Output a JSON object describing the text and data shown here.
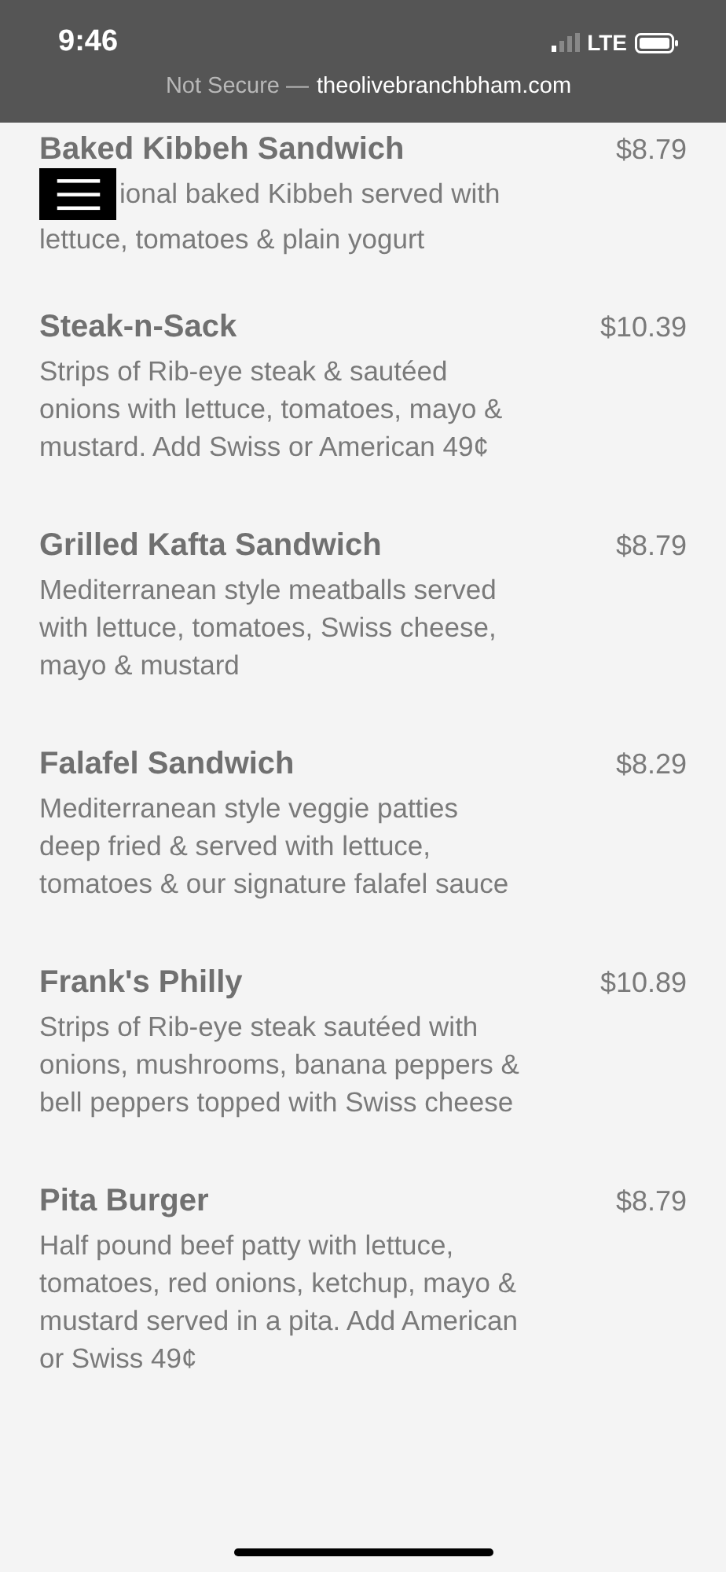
{
  "status_bar": {
    "time": "9:46",
    "network": "LTE"
  },
  "address_bar": {
    "security": "Not Secure —",
    "domain": "theolivebranchbham.com"
  },
  "menu_items": [
    {
      "name": "Baked Kibbeh Sandwich",
      "price": "$8.79",
      "description_lines": [
        "ional baked Kibbeh served with",
        "lettuce, tomatoes & plain yogurt"
      ]
    },
    {
      "name": "Steak-n-Sack",
      "price": "$10.39",
      "description": "Strips of Rib-eye steak & sautéed onions with lettuce, tomatoes, mayo & mustard. Add Swiss or American 49¢"
    },
    {
      "name": "Grilled Kafta Sandwich",
      "price": "$8.79",
      "description": "Mediterranean style meatballs served with lettuce, tomatoes, Swiss cheese, mayo & mustard"
    },
    {
      "name": "Falafel Sandwich",
      "price": "$8.29",
      "description": "Mediterranean style veggie patties deep fried & served with lettuce, tomatoes & our signature falafel sauce"
    },
    {
      "name": "Frank's Philly",
      "price": "$10.89",
      "description": "Strips of Rib-eye steak sautéed with onions, mushrooms, banana peppers & bell peppers topped with Swiss cheese"
    },
    {
      "name": "Pita Burger",
      "price": "$8.79",
      "description": "Half pound beef patty with lettuce, tomatoes, red onions, ketchup, mayo & mustard served in a pita. Add American or Swiss 49¢"
    }
  ]
}
